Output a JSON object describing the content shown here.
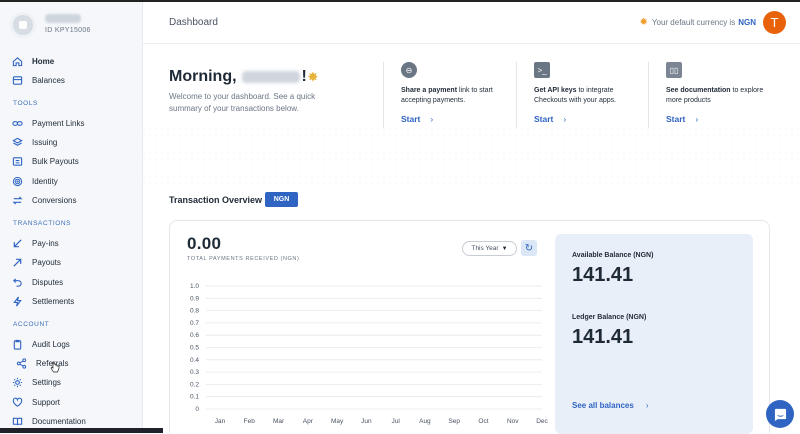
{
  "sidebar": {
    "profile_id": "ID KPY15006",
    "sections": {
      "tools": "TOOLS",
      "transactions": "TRANSACTIONS",
      "account": "ACCOUNT"
    },
    "items": {
      "home": "Home",
      "balances": "Balances",
      "payment_links": "Payment Links",
      "issuing": "Issuing",
      "bulk_payouts": "Bulk Payouts",
      "identity": "Identity",
      "conversions": "Conversions",
      "payins": "Pay-ins",
      "payouts": "Payouts",
      "disputes": "Disputes",
      "settlements": "Settlements",
      "audit_logs": "Audit Logs",
      "referrals": "Referrals",
      "settings": "Settings",
      "support": "Support",
      "documentation": "Documentation"
    }
  },
  "header": {
    "title": "Dashboard",
    "currency_text": "Your default currency is",
    "currency_value": "NGN",
    "user_initial": "T"
  },
  "welcome": {
    "greeting": "Morning,",
    "exclaim": "!",
    "subtitle": "Welcome to your dashboard. See a quick summary of your transactions below."
  },
  "quick_actions": [
    {
      "bold": "Share a payment",
      "text": " link to start accepting payments.",
      "cta": "Start"
    },
    {
      "bold": "Get API keys",
      "text": " to integrate Checkouts with your apps.",
      "cta": "Start"
    },
    {
      "bold": "See documentation",
      "text": " to explore more products",
      "cta": "Start"
    }
  ],
  "overview": {
    "title": "Transaction Overview",
    "currency_badge": "NGN",
    "total": "0.00",
    "total_label": "TOTAL PAYMENTS RECEIVED (NGN)",
    "period": "This Year",
    "available_label": "Available Balance (NGN)",
    "available_value": "141.41",
    "ledger_label": "Ledger Balance (NGN)",
    "ledger_value": "141.41",
    "see_all": "See all balances"
  },
  "chart_data": {
    "type": "line",
    "categories": [
      "Jan",
      "Feb",
      "Mar",
      "Apr",
      "May",
      "Jun",
      "Jul",
      "Aug",
      "Sep",
      "Oct",
      "Nov",
      "Dec"
    ],
    "y_ticks": [
      "1.0",
      "0.9",
      "0.8",
      "0.7",
      "0.6",
      "0.5",
      "0.4",
      "0.3",
      "0.2",
      "0.1",
      "0"
    ],
    "ylim": [
      0,
      1
    ],
    "grid": true,
    "series": []
  },
  "colors": {
    "accent": "#2f64c3",
    "avatar": "#e8620c",
    "balance_bg": "#e9eff8"
  }
}
